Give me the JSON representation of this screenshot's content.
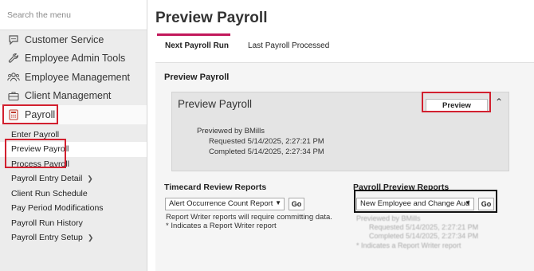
{
  "sidebar": {
    "search_placeholder": "Search the menu",
    "items": [
      {
        "label": "Customer Service",
        "icon": "chat-icon"
      },
      {
        "label": "Employee Admin Tools",
        "icon": "wrench-icon"
      },
      {
        "label": "Employee Management",
        "icon": "people-icon"
      },
      {
        "label": "Client Management",
        "icon": "briefcase-icon"
      },
      {
        "label": "Payroll",
        "icon": "calculator-icon"
      }
    ],
    "payroll_sub": [
      {
        "label": "Enter Payroll"
      },
      {
        "label": "Preview Payroll"
      },
      {
        "label": "Process Payroll"
      },
      {
        "label": "Payroll Entry Detail"
      },
      {
        "label": "Client Run Schedule"
      },
      {
        "label": "Pay Period Modifications"
      },
      {
        "label": "Payroll Run History"
      },
      {
        "label": "Payroll Entry Setup"
      }
    ]
  },
  "main": {
    "title": "Preview Payroll",
    "tabs": [
      {
        "label": "Next Payroll Run"
      },
      {
        "label": "Last Payroll Processed"
      }
    ],
    "section_title": "Preview Payroll",
    "panel": {
      "title": "Preview Payroll",
      "button": "Preview",
      "previewed_by": "Previewed by BMills",
      "requested": "Requested 5/14/2025, 2:27:21 PM",
      "completed": "Completed 5/14/2025, 2:27:34 PM"
    },
    "timecard": {
      "title": "Timecard Review Reports",
      "selected": "Alert Occurrence Count Report",
      "go": "Go",
      "note1": "Report Writer reports will require committing data.",
      "note2": "* Indicates a Report Writer report"
    },
    "payroll_preview": {
      "title": "Payroll Preview Reports",
      "selected": "New Employee and Change Aud",
      "go": "Go",
      "blurred_previewed_by": "Previewed by BMills",
      "blurred_requested": "Requested 5/14/2025, 2:27:21 PM",
      "blurred_completed": "Completed 5/14/2025, 2:27:34 PM",
      "blurred_note": "* Indicates a Report Writer report"
    }
  },
  "colors": {
    "highlight_red": "#d2202f",
    "highlight_black": "#111111",
    "tab_accent": "#c2185b"
  }
}
